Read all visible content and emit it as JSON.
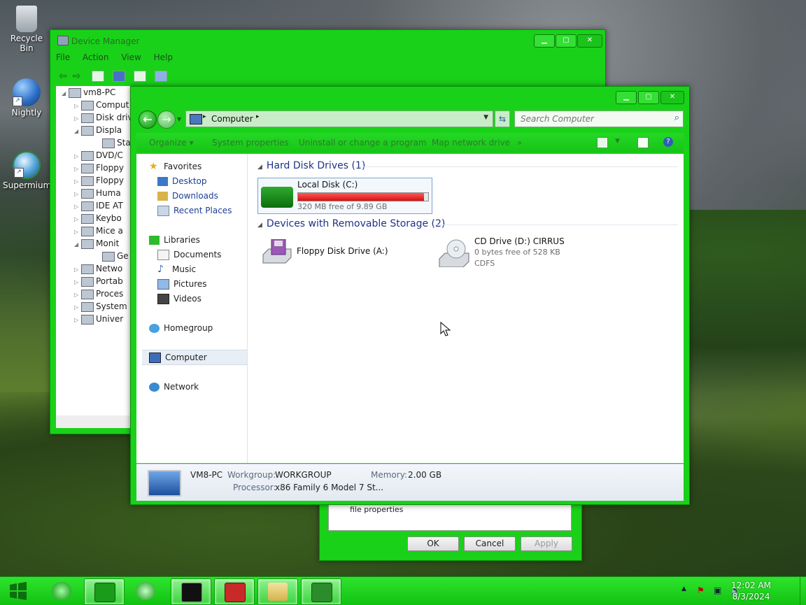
{
  "desktop": {
    "icons": [
      {
        "label": "Recycle Bin",
        "icon": "recycle-bin-icon"
      },
      {
        "label": "Nightly",
        "icon": "nightly-browser-icon"
      },
      {
        "label": "Supermium",
        "icon": "supermium-browser-icon"
      }
    ]
  },
  "device_manager": {
    "title": "Device Manager",
    "menu": [
      "File",
      "Action",
      "View",
      "Help"
    ],
    "tree": [
      {
        "label": "vm8-PC",
        "arrow": "◢"
      },
      {
        "label": "Comput",
        "arrow": "▷"
      },
      {
        "label": "Disk driv",
        "arrow": "▷"
      },
      {
        "label": "Displa",
        "arrow": "◢"
      },
      {
        "label": "Sta",
        "arrow": ""
      },
      {
        "label": "DVD/C",
        "arrow": "▷"
      },
      {
        "label": "Floppy",
        "arrow": "▷"
      },
      {
        "label": "Floppy",
        "arrow": "▷"
      },
      {
        "label": "Huma",
        "arrow": "▷"
      },
      {
        "label": "IDE AT",
        "arrow": "▷"
      },
      {
        "label": "Keybo",
        "arrow": "▷"
      },
      {
        "label": "Mice a",
        "arrow": "▷"
      },
      {
        "label": "Monit",
        "arrow": "◢"
      },
      {
        "label": "Ge",
        "arrow": ""
      },
      {
        "label": "Netwo",
        "arrow": "▷"
      },
      {
        "label": "Portab",
        "arrow": "▷"
      },
      {
        "label": "Proces",
        "arrow": "▷"
      },
      {
        "label": "System",
        "arrow": "▷"
      },
      {
        "label": "Univer",
        "arrow": "▷"
      }
    ]
  },
  "properties_dialog": {
    "text": "file properties",
    "ok": "OK",
    "cancel": "Cancel",
    "apply": "Apply"
  },
  "explorer": {
    "address": {
      "location": "Computer"
    },
    "search_placeholder": "Search Computer",
    "commands": [
      "Organize ▾",
      "System properties",
      "Uninstall or change a program",
      "Map network drive",
      "»"
    ],
    "nav": {
      "favorites": "Favorites",
      "desktop": "Desktop",
      "downloads": "Downloads",
      "recent": "Recent Places",
      "libraries": "Libraries",
      "documents": "Documents",
      "music": "Music",
      "pictures": "Pictures",
      "videos": "Videos",
      "homegroup": "Homegroup",
      "computer": "Computer",
      "network": "Network"
    },
    "groups": {
      "hdd": "Hard Disk Drives (1)",
      "removable": "Devices with Removable Storage (2)"
    },
    "drives": {
      "c_name": "Local Disk (C:)",
      "c_free": "320 MB free of 9.89 GB",
      "c_used_fraction": 0.97,
      "floppy_name": "Floppy Disk Drive (A:)",
      "cd_name": "CD Drive (D:) CIRRUS",
      "cd_free": "0 bytes free of 528 KB",
      "cd_fs": "CDFS"
    },
    "details": {
      "name": "VM8-PC",
      "workgroup_label": "Workgroup:",
      "workgroup": "WORKGROUP",
      "memory_label": "Memory:",
      "memory": "2.00 GB",
      "processor_label": "Processor:",
      "processor": "x86 Family 6 Model 7 St..."
    }
  },
  "taskbar": {
    "time": "12:02 AM",
    "date": "8/3/2024",
    "colors": {
      "accent": "#19d119",
      "dark": "#0a8f0a"
    }
  }
}
